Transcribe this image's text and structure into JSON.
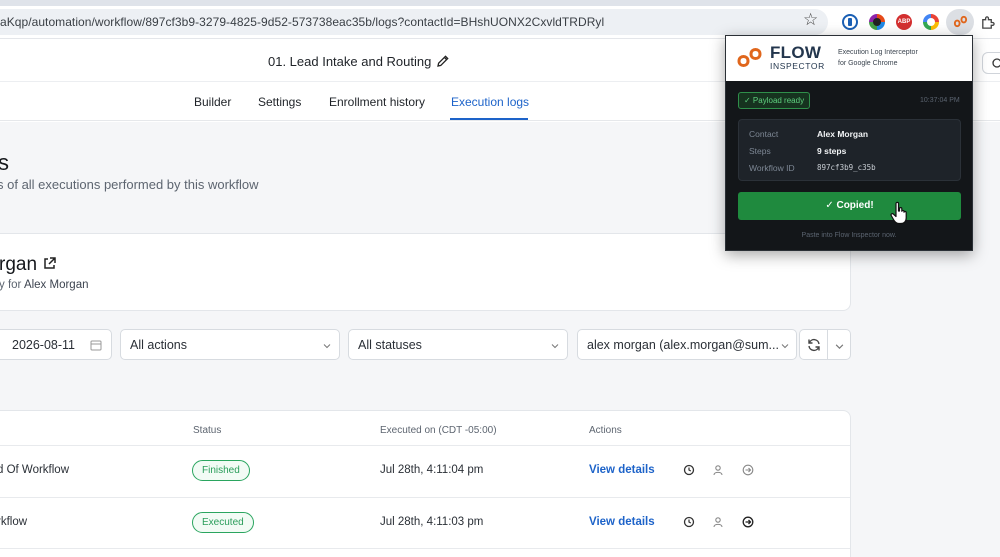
{
  "browser": {
    "url": "aKqp/automation/workflow/897cf3b9-3279-4825-9d52-573738eac35b/logs?contactId=BHshUONX2CxvldTRDRyl",
    "bookmark_icon": "star-icon",
    "extensions": [
      "password-manager-icon",
      "color-picker-icon",
      "adblock-icon",
      "chrome-color-icon",
      "flow-inspector-icon",
      "puzzle-extensions-icon"
    ],
    "adblock_label": "ABP"
  },
  "header": {
    "workflow_title": "01. Lead Intake and Routing"
  },
  "tabs": [
    {
      "label": "Builder"
    },
    {
      "label": "Settings"
    },
    {
      "label": "Enrollment history"
    },
    {
      "label": "Execution logs",
      "active": true
    }
  ],
  "page": {
    "heading": "s",
    "subtitle": "s of all executions performed by this workflow"
  },
  "contact_card": {
    "name": "rgan",
    "subtitle_prefix": "y for",
    "subtitle_name": "Alex Morgan"
  },
  "filters": {
    "date": "2026-08-11",
    "actions": "All actions",
    "statuses": "All statuses",
    "contact": "alex morgan (alex.morgan@sum..."
  },
  "table": {
    "headers": [
      "Status",
      "Executed on (CDT -05:00)",
      "Actions"
    ],
    "rows": [
      {
        "action": "d Of Workflow",
        "status": "Finished",
        "executed_on": "Jul 28th, 4:11:04 pm",
        "link": "View details"
      },
      {
        "action": "rkflow",
        "status": "Executed",
        "executed_on": "Jul 28th, 4:11:03 pm",
        "link": "View details"
      }
    ]
  },
  "popup": {
    "brand_top": "FLOW",
    "brand_bottom": "INSPECTOR",
    "tagline_1": "Execution Log Interceptor",
    "tagline_2": "for Google Chrome",
    "ready": "✓ Payload ready",
    "time": "10:37:04 PM",
    "contact_label": "Contact",
    "contact_value": "Alex Morgan",
    "steps_label": "Steps",
    "steps_value": "9 steps",
    "workflow_label": "Workflow ID",
    "workflow_value": "897cf3b9_c35b",
    "button": "✓ Copied!",
    "footer": "Paste into Flow Inspector now."
  },
  "colors": {
    "accent": "#1d63c9",
    "success": "#2a9d5a",
    "popup_bg": "#131619",
    "copied_button": "#1f8a3e"
  }
}
